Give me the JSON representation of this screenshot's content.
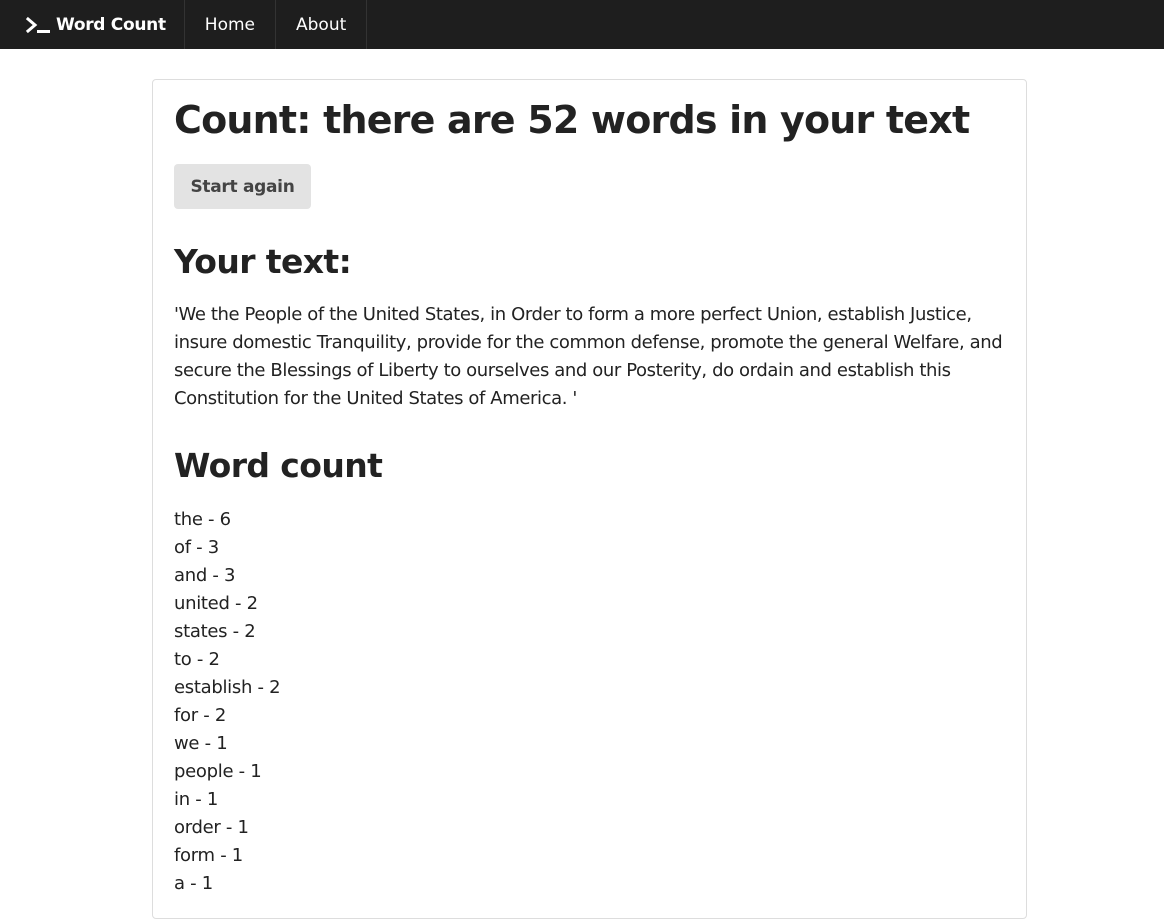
{
  "navbar": {
    "brand_icon": "terminal-prompt-icon",
    "brand_label": "Word Count",
    "links": [
      "Home",
      "About"
    ]
  },
  "main": {
    "title": "Count: there are 52 words in your text",
    "start_again_label": "Start again",
    "your_text_heading": "Your text:",
    "your_text_body": "'We the People of the United States, in Order to form a more perfect Union, establish Justice, insure domestic Tranquility, provide for the common defense, promote the general Welfare, and secure the Blessings of Liberty to ourselves and our Posterity, do ordain and establish this Constitution for the United States of America. '",
    "word_count_heading": "Word count",
    "word_counts": [
      "the - 6",
      "of - 3",
      "and - 3",
      "united - 2",
      "states - 2",
      "to - 2",
      "establish - 2",
      "for - 2",
      "we - 1",
      "people - 1",
      "in - 1",
      "order - 1",
      "form - 1",
      "a - 1"
    ]
  },
  "colors": {
    "navbar_bg": "#1e1e1e",
    "button_bg": "#e3e3e3",
    "text": "#222222"
  }
}
